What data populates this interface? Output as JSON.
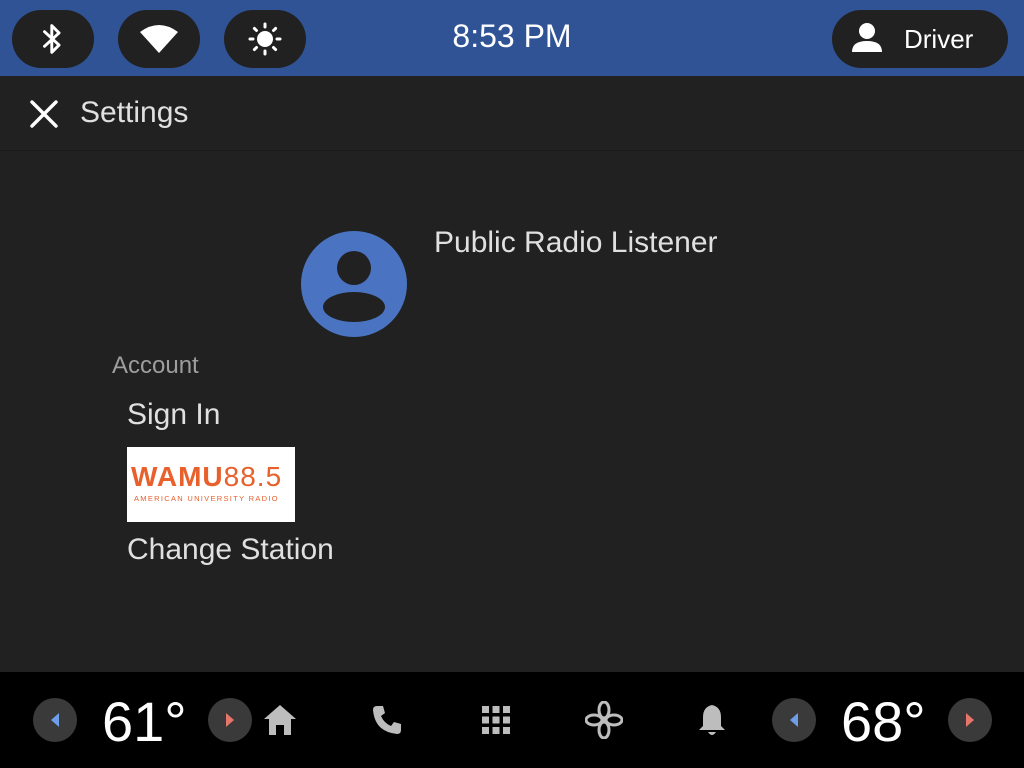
{
  "status_bar": {
    "time": "8:53 PM",
    "user_label": "Driver",
    "icons": [
      "bluetooth-icon",
      "wifi-icon",
      "brightness-icon",
      "person-icon"
    ]
  },
  "app_bar": {
    "title": "Settings",
    "close_icon": "close-icon"
  },
  "profile": {
    "name": "Public Radio Listener",
    "avatar_icon": "account-circle-icon"
  },
  "account": {
    "header": "Account",
    "sign_in_label": "Sign In",
    "station_logo": {
      "brand": "WAMU",
      "frequency": "88.5",
      "tagline": "AMERICAN UNIVERSITY RADIO"
    },
    "change_station_label": "Change Station"
  },
  "nav_bar": {
    "left_temp": "61°",
    "right_temp": "68°",
    "icons": [
      "home-icon",
      "phone-icon",
      "apps-grid-icon",
      "fan-icon",
      "notification-bell-icon"
    ]
  },
  "colors": {
    "status_bar_bg": "#2f5394",
    "background": "#212121",
    "nav_bg": "#000000",
    "accent_blue": "#4a74c2",
    "decrease_arrow": "#6f9ee8",
    "increase_arrow": "#e8756a",
    "logo_orange": "#e8602c"
  }
}
